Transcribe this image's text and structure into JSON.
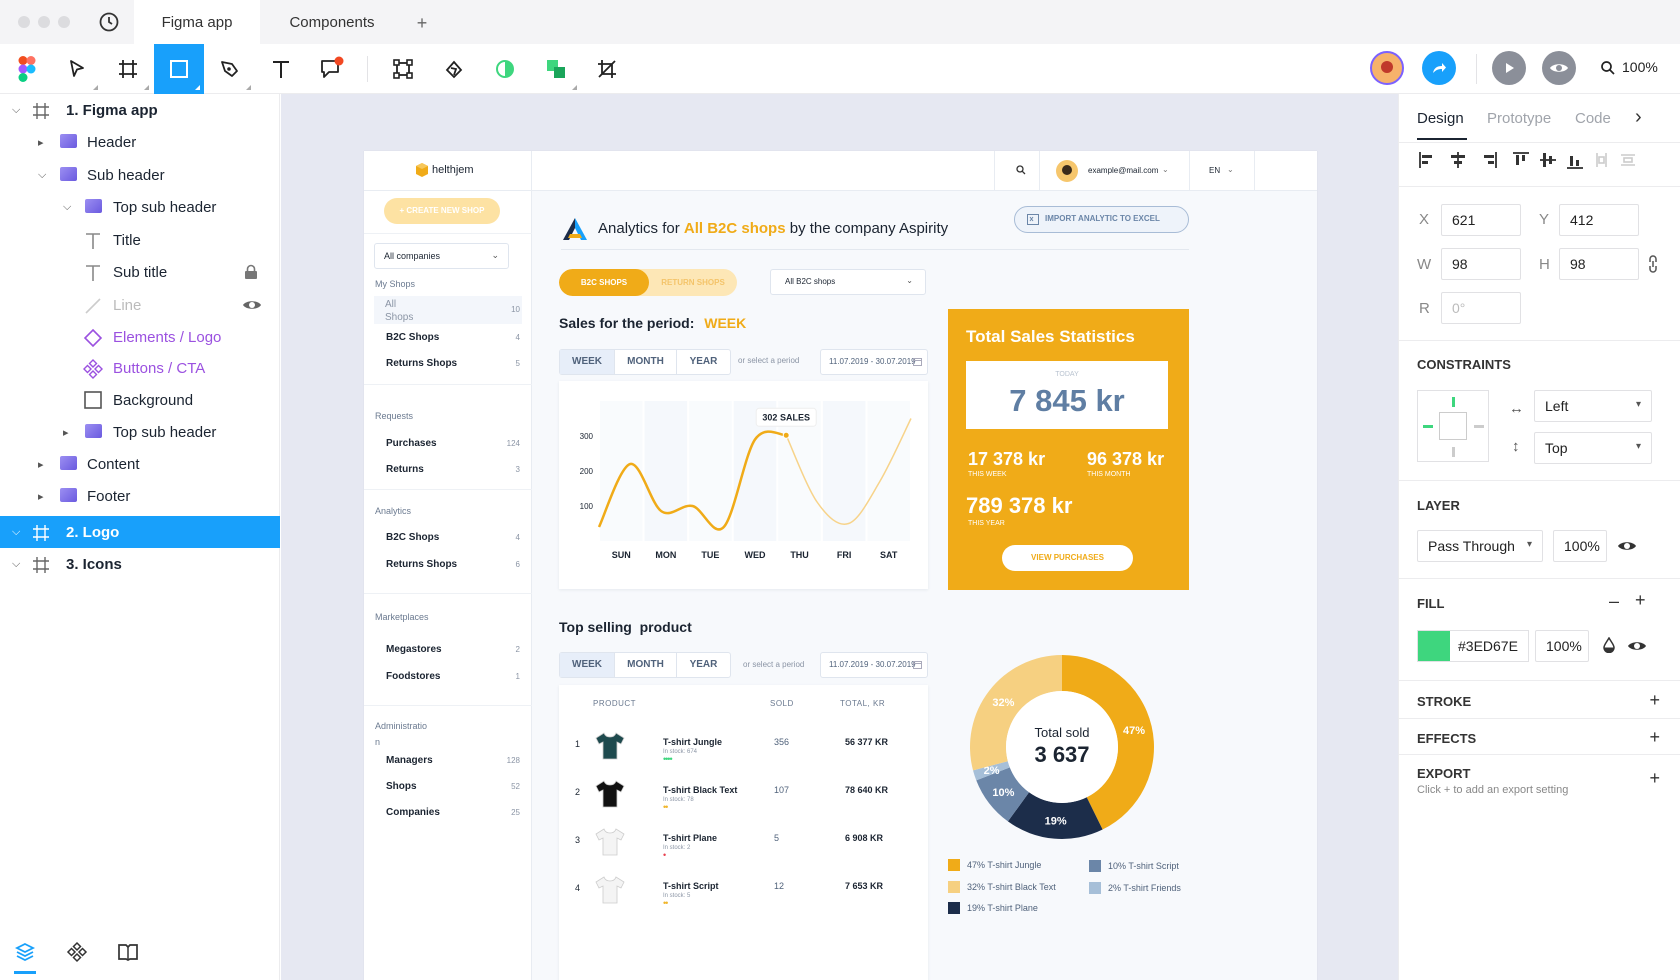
{
  "window": {
    "tabs": [
      {
        "label": "Figma app"
      },
      {
        "label": "Components"
      }
    ],
    "new_tab": "+",
    "zoom": "100%"
  },
  "layers": {
    "items": [
      {
        "label": "1. Figma app",
        "type": "frame"
      },
      {
        "label": "Header",
        "type": "group"
      },
      {
        "label": "Sub header",
        "type": "group"
      },
      {
        "label": "Top sub header",
        "type": "group"
      },
      {
        "label": "Title",
        "type": "text"
      },
      {
        "label": "Sub title",
        "type": "text"
      },
      {
        "label": "Line",
        "type": "line"
      },
      {
        "label": "Elements / Logo",
        "type": "component"
      },
      {
        "label": "Buttons / CTA",
        "type": "component-set"
      },
      {
        "label": "Background",
        "type": "rect"
      },
      {
        "label": "Top sub header",
        "type": "group"
      },
      {
        "label": "Content",
        "type": "group"
      },
      {
        "label": "Footer",
        "type": "group"
      },
      {
        "label": "2. Logo",
        "type": "frame"
      },
      {
        "label": "3. Icons",
        "type": "frame"
      }
    ]
  },
  "design": {
    "brand": "helthjem",
    "user_email": "example@mail.com",
    "lang": "EN",
    "create_btn": "+ CREATE NEW SHOP",
    "company_select": "All companies",
    "sidebar": {
      "my_shops": "My Shops",
      "my_shops_items": [
        {
          "label": "All",
          "label2": "Shops",
          "count": "10"
        },
        {
          "label": "B2C Shops",
          "count": "4"
        },
        {
          "label": "Returns Shops",
          "count": "5"
        }
      ],
      "requests": "Requests",
      "requests_items": [
        {
          "label": "Purchases",
          "count": "124"
        },
        {
          "label": "Returns",
          "count": "3"
        }
      ],
      "analytics": "Analytics",
      "analytics_items": [
        {
          "label": "B2C Shops",
          "count": "4"
        },
        {
          "label": "Returns Shops",
          "count": "6"
        }
      ],
      "marketplaces": "Marketplaces",
      "marketplaces_items": [
        {
          "label": "Megastores",
          "count": "2"
        },
        {
          "label": "Foodstores",
          "count": "1"
        }
      ],
      "admin": "Administratio",
      "admin2": "n",
      "admin_items": [
        {
          "label": "Managers",
          "count": "128"
        },
        {
          "label": "Shops",
          "count": "52"
        },
        {
          "label": "Companies",
          "count": "25"
        }
      ]
    },
    "heading": {
      "prefix": "Analytics for ",
      "highlight": "All B2C shops",
      "suffix": " by the company Aspirity"
    },
    "import_btn": "IMPORT ANALYTIC TO EXCEL",
    "shop_tabs": {
      "b2c": "B2C SHOPS",
      "returns": "RETURN SHOPS"
    },
    "shop_select": "All B2C shops",
    "sales": {
      "title": "Sales for the period:",
      "period": "WEEK",
      "periods": [
        "WEEK",
        "MONTH",
        "YEAR"
      ],
      "or_select": "or select a period",
      "date_range": "11.07.2019 - 30.07.2019"
    },
    "stats": {
      "title": "Total Sales Statistics",
      "today_label": "TODAY",
      "today_value": "7 845 kr",
      "week_value": "17 378 kr",
      "week_label": "THIS WEEK",
      "month_value": "96 378 kr",
      "month_label": "THIS MONTH",
      "year_value": "789 378 kr",
      "year_label": "THIS YEAR",
      "button": "VIEW PURCHASES"
    },
    "top_selling": {
      "title": "Top selling  product",
      "periods": [
        "WEEK",
        "MONTH",
        "YEAR"
      ],
      "or_select": "or select a period",
      "date_range": "11.07.2019 - 30.07.2019",
      "columns": {
        "product": "PRODUCT",
        "sold": "SOLD",
        "total": "TOTAL, KR"
      },
      "rows": [
        {
          "rank": "1",
          "name": "T-shirt Jungle",
          "stock": "In stock: 674",
          "sold": "356",
          "total": "56 377 KR",
          "dots": "••••",
          "dot_color": "#3ed67e",
          "shirt": "#1e4a4e"
        },
        {
          "rank": "2",
          "name": "T-shirt Black Text",
          "stock": "In stock: 78",
          "sold": "107",
          "total": "78 640 KR",
          "dots": "••",
          "dot_color": "#f0b62c",
          "shirt": "#111111"
        },
        {
          "rank": "3",
          "name": "T-shirt Plane",
          "stock": "In stock: 2",
          "sold": "5",
          "total": "6 908 KR",
          "dots": "•",
          "dot_color": "#e8404f",
          "shirt": "#f4f4f4"
        },
        {
          "rank": "4",
          "name": "T-shirt Script",
          "stock": "In stock: 5",
          "sold": "12",
          "total": "7 653 KR",
          "dots": "••",
          "dot_color": "#f0b62c",
          "shirt": "#f4f4f4"
        }
      ]
    },
    "donut": {
      "center_title": "Total sold",
      "center_value": "3 637"
    }
  },
  "chart_data": [
    {
      "type": "line",
      "categories": [
        "SUN",
        "MON",
        "TUE",
        "WED",
        "THU",
        "FRI",
        "SAT"
      ],
      "yticks": [
        100,
        200,
        300
      ],
      "annotation": "302 SALES",
      "series": [
        {
          "values": [
            40,
            220,
            85,
            100,
            40,
            290,
            302,
            110,
            50,
            170,
            350
          ]
        }
      ]
    },
    {
      "type": "pie",
      "title": "Total sold",
      "slices": [
        {
          "label": "T-shirt Jungle",
          "value": 47,
          "text": "47%",
          "color": "#f0ab18"
        },
        {
          "label": "T-shirt Script",
          "value": 10,
          "text": "10%",
          "color": "#6b86a8"
        },
        {
          "label": "T-shirt Black Text",
          "value": 32,
          "text": "32%",
          "color": "#f6d081"
        },
        {
          "label": "T-shirt Friends",
          "value": 2,
          "text": "2%",
          "color": "#a6bfd8"
        },
        {
          "label": "T-shirt Plane",
          "value": 19,
          "text": "19%",
          "color": "#1c2d4a"
        }
      ],
      "legend": [
        {
          "text": "47%  T-shirt Jungle",
          "color": "#f0ab18"
        },
        {
          "text": "10%   T-shirt Script",
          "color": "#6b86a8"
        },
        {
          "text": "32%  T-shirt Black Text",
          "color": "#f6d081"
        },
        {
          "text": "2%    T-shirt Friends",
          "color": "#a6bfd8"
        },
        {
          "text": "19%  T-shirt Plane",
          "color": "#1c2d4a"
        }
      ]
    }
  ],
  "props": {
    "tabs": [
      "Design",
      "Prototype",
      "Code"
    ],
    "x_label": "X",
    "x": "621",
    "y_label": "Y",
    "y": "412",
    "w_label": "W",
    "w": "98",
    "h_label": "H",
    "h": "98",
    "r_label": "R",
    "r": "0°",
    "constraints": "CONSTRAINTS",
    "h_constraint": "Left",
    "v_constraint": "Top",
    "layer": "LAYER",
    "blend": "Pass Through",
    "layer_opacity": "100%",
    "fill": "FILL",
    "fill_color": "#3ED67E",
    "fill_hex": "#3ED67E",
    "fill_opacity": "100%",
    "stroke": "STROKE",
    "effects": "EFFECTS",
    "export": "EXPORT",
    "export_hint": "Click + to add an export setting"
  },
  "colors": {
    "accent": "#18a0fb",
    "brand_orange": "#f0ab18",
    "green": "#3ed67e"
  }
}
